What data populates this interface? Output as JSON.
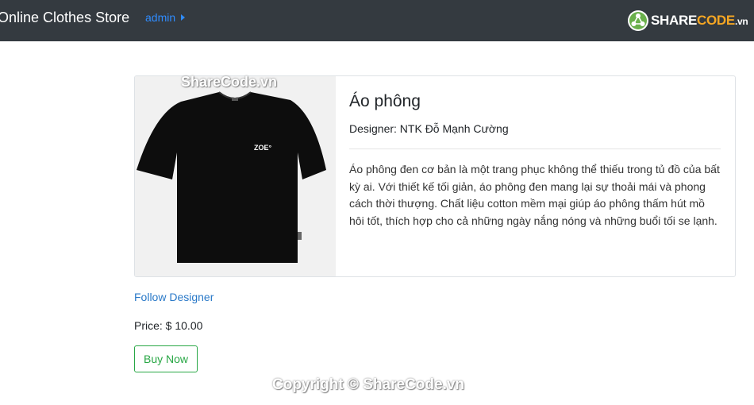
{
  "navbar": {
    "brand": "Online Clothes Store",
    "user": "admin",
    "logo_text_a": "SHARE",
    "logo_text_b": "CODE",
    "logo_text_c": ".vn"
  },
  "product": {
    "title": "Áo phông",
    "designer": "Designer: NTK Đỗ Mạnh Cường",
    "description": "Áo phông đen cơ bản là một trang phục không thể thiếu trong tủ đồ của bất kỳ ai. Với thiết kế tối giản, áo phông đen mang lại sự thoải mái và phong cách thời thượng. Chất liệu cotton mềm mại giúp áo phông thấm hút mồ hôi tốt, thích hợp cho cả những ngày nắng nóng và những buổi tối se lạnh.",
    "image_label": "ZOE°",
    "follow_label": "Follow Designer",
    "price": "Price: $ 10.00",
    "buy_label": "Buy Now"
  },
  "watermarks": {
    "top": "ShareCode.vn",
    "bottom": "Copyright © ShareCode.vn"
  },
  "colors": {
    "navbar": "#343a40",
    "link": "#2a79c8",
    "success": "#28a745"
  }
}
